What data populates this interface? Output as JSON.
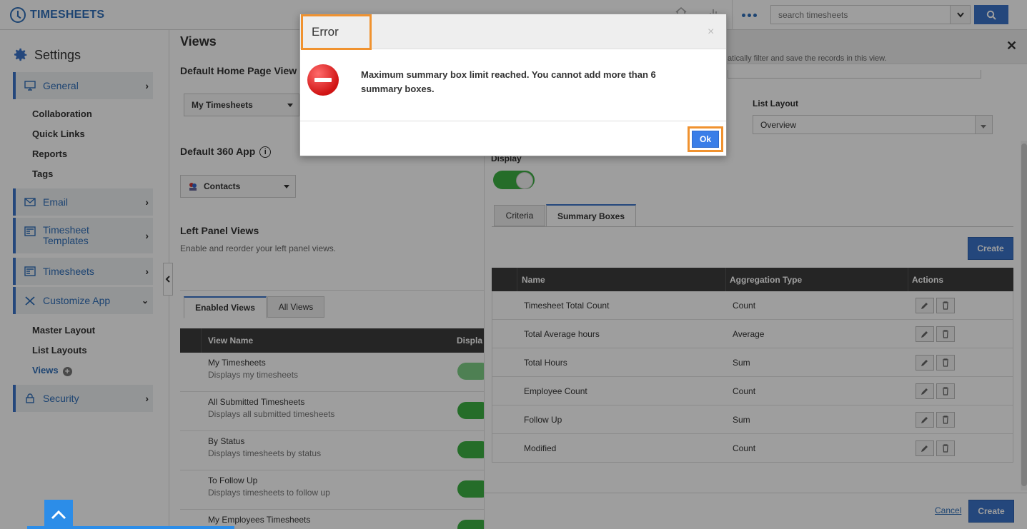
{
  "app": {
    "title": "TIMESHEETS"
  },
  "search": {
    "placeholder": "search timesheets"
  },
  "sidebar": {
    "heading": "Settings",
    "sections": [
      {
        "label": "General",
        "icon": "monitor-icon"
      },
      {
        "label": "Email",
        "icon": "envelope-icon"
      },
      {
        "label": "Timesheet Templates",
        "icon": "template-icon"
      },
      {
        "label": "Timesheets",
        "icon": "template-icon"
      },
      {
        "label": "Customize App",
        "icon": "tools-icon"
      },
      {
        "label": "Security",
        "icon": "lock-icon"
      }
    ],
    "general_links": [
      "Collaboration",
      "Quick Links",
      "Reports",
      "Tags"
    ],
    "customize_links": [
      "Master Layout",
      "List Layouts",
      "Views"
    ]
  },
  "main": {
    "title": "Views",
    "default_home_label": "Default Home Page View",
    "default_home_value": "My Timesheets",
    "default_360_label": "Default 360 App",
    "default_360_value": "Contacts",
    "left_panel_label": "Left Panel Views",
    "left_panel_desc": "Enable and reorder your left panel views.",
    "tabs": [
      "Enabled Views",
      "All Views"
    ],
    "table_headers": [
      "View Name",
      "Displa"
    ],
    "rows": [
      {
        "title": "My Timesheets",
        "desc": "Displays my timesheets"
      },
      {
        "title": "All Submitted Timesheets",
        "desc": "Displays all submitted timesheets"
      },
      {
        "title": "By Status",
        "desc": "Displays timesheets by status"
      },
      {
        "title": "To Follow Up",
        "desc": "Displays timesheets to follow up"
      },
      {
        "title": "My Employees Timesheets",
        "desc": ""
      }
    ]
  },
  "panel": {
    "filter_note": "atically filter and save the records in this view.",
    "list_layout_label": "List Layout",
    "list_layout_value": "Overview",
    "display_label": "Display",
    "tabs": [
      "Criteria",
      "Summary Boxes"
    ],
    "create_label": "Create",
    "table_headers": [
      "Name",
      "Aggregation Type",
      "Actions"
    ],
    "rows": [
      {
        "name": "Timesheet Total Count",
        "agg": "Count"
      },
      {
        "name": "Total Average hours",
        "agg": "Average"
      },
      {
        "name": "Total Hours",
        "agg": "Sum"
      },
      {
        "name": "Employee Count",
        "agg": "Count"
      },
      {
        "name": "Follow Up",
        "agg": "Sum"
      },
      {
        "name": "Modified",
        "agg": "Count"
      }
    ],
    "cancel_label": "Cancel",
    "footer_create_label": "Create"
  },
  "modal": {
    "title": "Error",
    "message": "Maximum summary box limit reached. You cannot add more than 6 summary boxes.",
    "ok_label": "Ok",
    "close_glyph": "×"
  },
  "colors": {
    "accent": "#3a73c9",
    "highlight": "#f0922f",
    "error": "#d01414",
    "toggle": "#3cb043"
  }
}
